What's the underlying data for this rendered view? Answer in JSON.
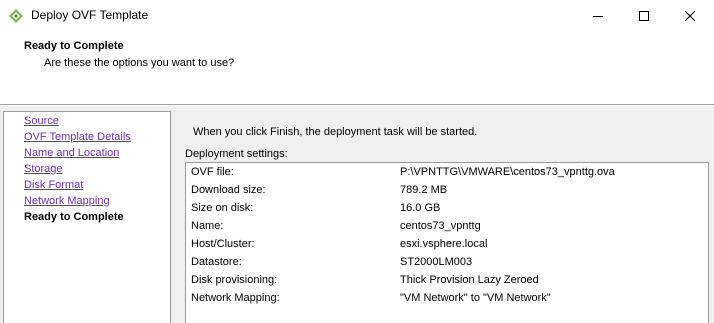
{
  "window": {
    "title": "Deploy OVF Template",
    "app_icon": "vsphere-logo-icon",
    "controls": [
      "minimize-icon",
      "maximize-icon",
      "close-icon"
    ]
  },
  "header": {
    "title": "Ready to Complete",
    "subtitle": "Are these the options you want to use?"
  },
  "nav": {
    "items": [
      {
        "label": "Source"
      },
      {
        "label": "OVF Template Details"
      },
      {
        "label": "Name and Location"
      },
      {
        "label": "Storage"
      },
      {
        "label": "Disk Format"
      },
      {
        "label": "Network Mapping"
      },
      {
        "label": "Ready to Complete"
      }
    ]
  },
  "main": {
    "intro": "When you click Finish, the deployment task will be started.",
    "group_label": "Deployment settings:",
    "settings": [
      {
        "label": "OVF file:",
        "value": "P:\\VPNTTG\\VMWARE\\centos73_vpnttg.ova"
      },
      {
        "label": "Download size:",
        "value": "789.2 MB"
      },
      {
        "label": "Size on disk:",
        "value": "16.0 GB"
      },
      {
        "label": "Name:",
        "value": "centos73_vpnttg"
      },
      {
        "label": "Host/Cluster:",
        "value": "esxi.vsphere.local"
      },
      {
        "label": "Datastore:",
        "value": "ST2000LM003"
      },
      {
        "label": "Disk provisioning:",
        "value": "Thick Provision Lazy Zeroed"
      },
      {
        "label": "Network Mapping:",
        "value": "\"VM Network\" to \"VM Network\""
      }
    ]
  },
  "colors": {
    "link_visited": "#7030a0",
    "panel_border": "#9b9b9b",
    "background": "#f0f0f0"
  }
}
